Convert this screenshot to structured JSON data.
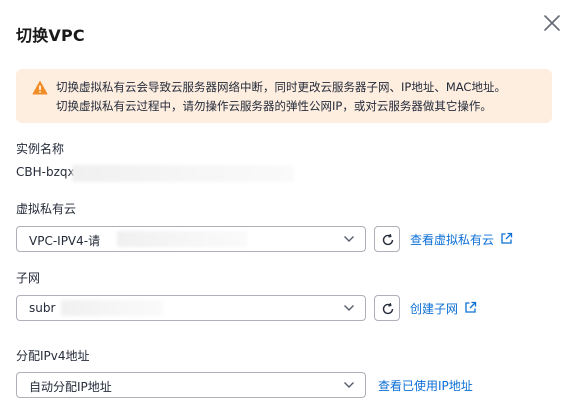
{
  "dialog": {
    "title": "切换VPC",
    "close_icon": "close-icon"
  },
  "warning": {
    "icon": "warning-triangle-icon",
    "line1": "切换虚拟私有云会导致云服务器网络中断，同时更改云服务器子网、IP地址、MAC地址。",
    "line2": "切换虚拟私有云过程中，请勿操作云服务器的弹性公网IP，或对云服务器做其它操作。"
  },
  "instance": {
    "label": "实例名称",
    "value": "CBH-bzqx"
  },
  "vpc": {
    "label": "虚拟私有云",
    "selected": "VPC-IPV4-请",
    "view_link": "查看虚拟私有云"
  },
  "subnet": {
    "label": "子网",
    "selected": "subr",
    "create_link": "创建子网"
  },
  "ipv4": {
    "label": "分配IPv4地址",
    "selected": "自动分配IP地址",
    "view_link": "查看已使用IP地址"
  },
  "colors": {
    "accent_link": "#0c6fd6",
    "warning_bg": "#fdeee0",
    "warning_icon": "#f18c27",
    "border": "#adb0b8"
  }
}
